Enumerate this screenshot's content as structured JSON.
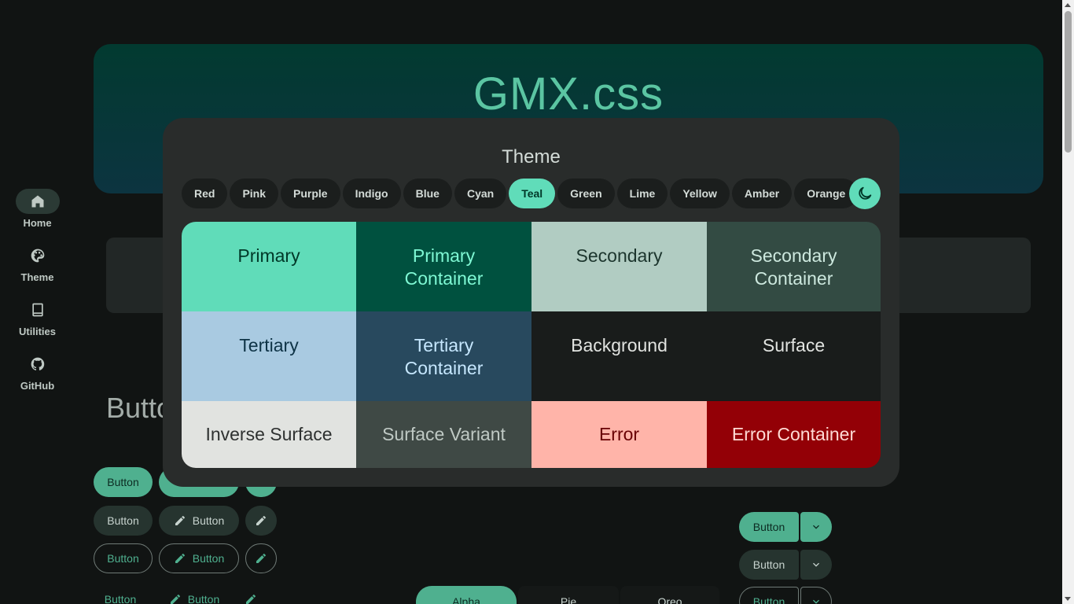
{
  "nav": {
    "items": [
      {
        "label": "Home",
        "icon": "home-icon",
        "active": true
      },
      {
        "label": "Theme",
        "icon": "palette-icon",
        "active": false
      },
      {
        "label": "Utilities",
        "icon": "book-icon",
        "active": false
      },
      {
        "label": "GitHub",
        "icon": "github-icon",
        "active": false
      }
    ]
  },
  "hero": {
    "title": "GMX.css"
  },
  "section": {
    "title": "Butto"
  },
  "buttons": {
    "label": "Button",
    "split_label": "Button",
    "segments": [
      "Alpha",
      "Pie",
      "Oreo"
    ]
  },
  "modal": {
    "title": "Theme",
    "chips": [
      "Red",
      "Pink",
      "Purple",
      "Indigo",
      "Blue",
      "Cyan",
      "Teal",
      "Green",
      "Lime",
      "Yellow",
      "Amber",
      "Orange"
    ],
    "selected_chip": "Teal",
    "dark_mode_icon": "moon-icon",
    "swatches": [
      {
        "label": "Primary",
        "bg": "#60dcb9",
        "fg": "#003828"
      },
      {
        "label": "Primary Container",
        "bg": "#00513f",
        "fg": "#7ff8d4"
      },
      {
        "label": "Secondary",
        "bg": "#b1ccc2",
        "fg": "#1c352d"
      },
      {
        "label": "Secondary Container",
        "bg": "#334b43",
        "fg": "#cde8de"
      },
      {
        "label": "Tertiary",
        "bg": "#a9cae1",
        "fg": "#0e3346"
      },
      {
        "label": "Tertiary Container",
        "bg": "#28495e",
        "fg": "#c6e7fe"
      },
      {
        "label": "Background",
        "bg": "#191c1b",
        "fg": "#e1e3e0"
      },
      {
        "label": "Surface",
        "bg": "#191c1b",
        "fg": "#e1e3e0"
      },
      {
        "label": "Inverse Surface",
        "bg": "#e1e3e0",
        "fg": "#2e3130"
      },
      {
        "label": "Surface Variant",
        "bg": "#3f4945",
        "fg": "#bfc9c4"
      },
      {
        "label": "Error",
        "bg": "#ffb4a9",
        "fg": "#680003"
      },
      {
        "label": "Error Container",
        "bg": "#930006",
        "fg": "#ffdad4"
      }
    ]
  }
}
